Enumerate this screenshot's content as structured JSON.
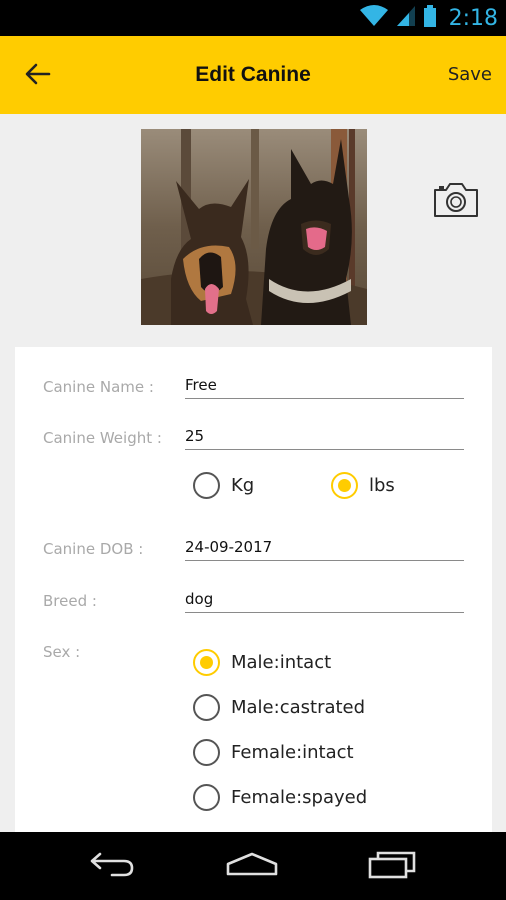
{
  "status_bar": {
    "time": "2:18",
    "icons": [
      "wifi-icon",
      "signal-icon",
      "battery-icon"
    ],
    "accent_color": "#33b5e5"
  },
  "app_bar": {
    "title": "Edit Canine",
    "save_label": "Save",
    "back_icon": "arrow-left-icon",
    "background": "#ffcc00"
  },
  "photo": {
    "alt": "Two dogs",
    "camera_icon": "camera-icon"
  },
  "form": {
    "name": {
      "label": "Canine Name :",
      "value": "Free"
    },
    "weight": {
      "label": "Canine Weight :",
      "value": "25"
    },
    "weight_units": [
      {
        "label": "Kg",
        "checked": false
      },
      {
        "label": "lbs",
        "checked": true
      }
    ],
    "dob": {
      "label": "Canine DOB :",
      "value": "24-09-2017"
    },
    "breed": {
      "label": "Breed :",
      "value": "dog"
    },
    "sex": {
      "label": "Sex :",
      "options": [
        {
          "label": "Male:intact",
          "checked": true
        },
        {
          "label": "Male:castrated",
          "checked": false
        },
        {
          "label": "Female:intact",
          "checked": false
        },
        {
          "label": "Female:spayed",
          "checked": false
        }
      ]
    }
  },
  "nav_bar": {
    "icons": [
      "back-nav-icon",
      "home-nav-icon",
      "recents-nav-icon"
    ]
  }
}
